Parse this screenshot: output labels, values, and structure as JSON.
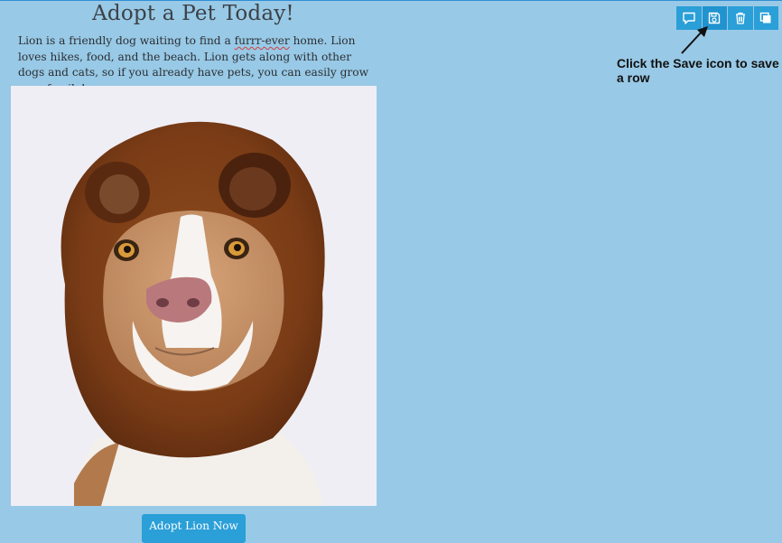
{
  "page": {
    "title": "Adopt a Pet Today!",
    "description_before": "Lion is a friendly dog waiting to find a ",
    "description_misspelled": "furrr-ever",
    "description_after": " home. Lion loves hikes, food, and the beach. Lion gets along with other dogs and cats, so if you already have pets, you can easily grow your family!",
    "cta_label": "Adopt Lion Now"
  },
  "toolbar": {
    "buttons": [
      {
        "icon": "comment-icon"
      },
      {
        "icon": "save-icon"
      },
      {
        "icon": "trash-icon"
      },
      {
        "icon": "duplicate-icon"
      }
    ]
  },
  "callout": {
    "text": "Click the Save icon to save a row"
  },
  "colors": {
    "background": "#98c9e6",
    "accent": "#2a9fd8"
  }
}
